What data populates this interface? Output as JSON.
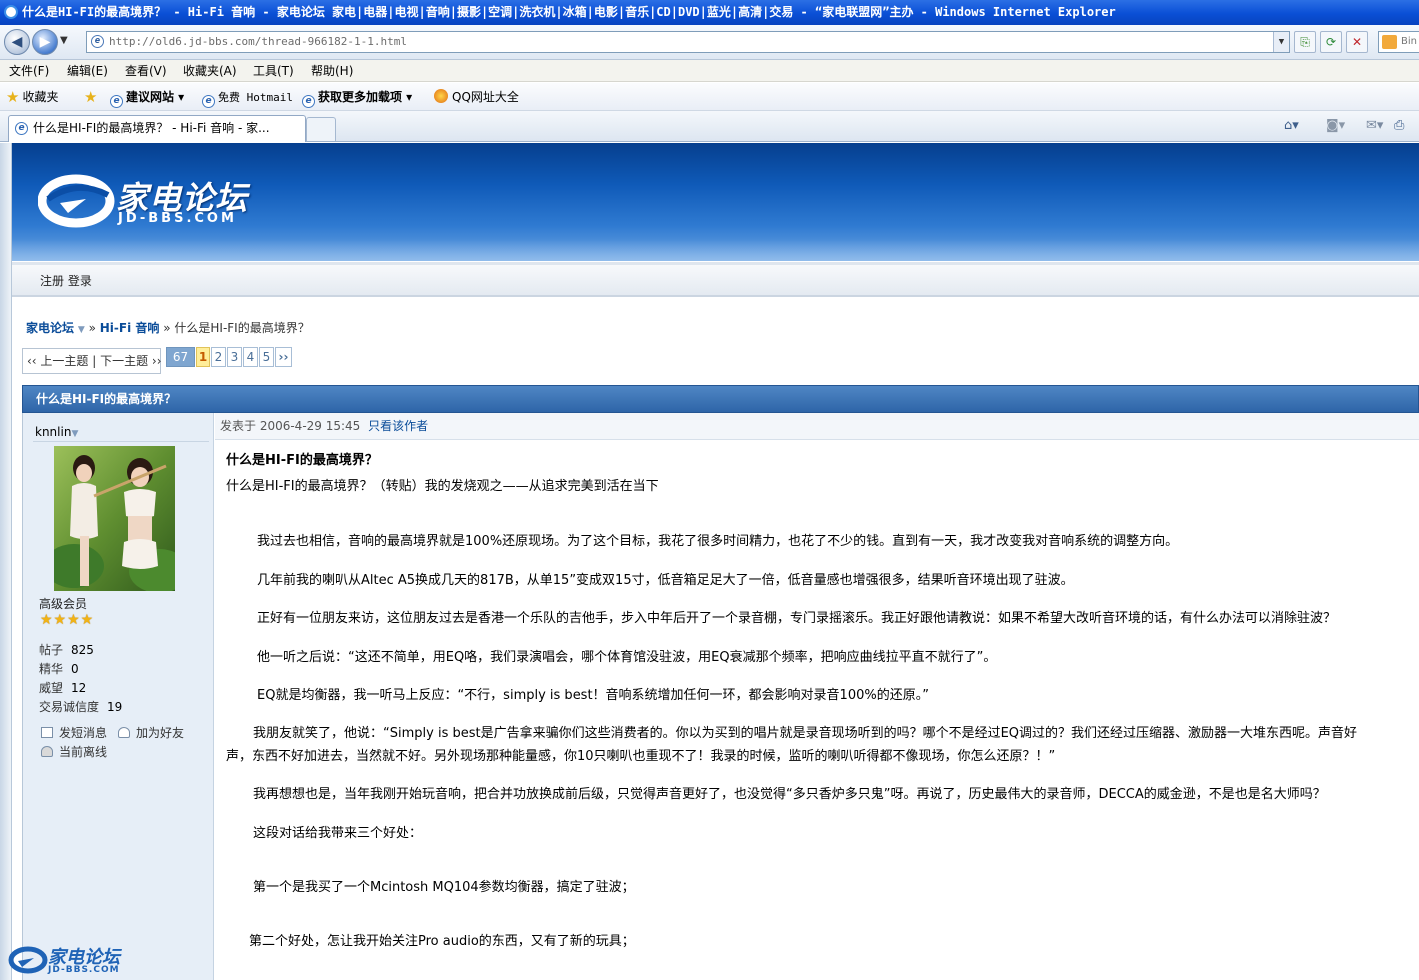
{
  "window": {
    "title": "什么是HI-FI的最高境界？ - Hi-Fi 音响 - 家电论坛 家电|电器|电视|音响|摄影|空调|洗衣机|冰箱|电影|音乐|CD|DVD|蓝光|高清|交易 - “家电联盟网”主办 - Windows Internet Explorer"
  },
  "address": {
    "url": "http://old6.jd-bbs.com/thread-966182-1-1.html",
    "search_text": "Bin"
  },
  "menu": [
    "文件(F)",
    "编辑(E)",
    "查看(V)",
    "收藏夹(A)",
    "工具(T)",
    "帮助(H)"
  ],
  "favorites": {
    "fav_label": "收藏夹",
    "items": [
      "建议网站 ▾",
      "免费 Hotmail",
      "获取更多加载项 ▾",
      "QQ网址大全"
    ]
  },
  "tab": {
    "label": "什么是HI-FI的最高境界？ - Hi-Fi 音响 - 家..."
  },
  "site": {
    "logo_text": "家电论坛",
    "logo_sub": "JD-BBS.COM",
    "login_links": "注册 登录",
    "watermark_text": "家电论坛",
    "watermark_sub": "JD-BBS.COM"
  },
  "breadcrumb": {
    "home": "家电论坛",
    "sep1": " » ",
    "forum": "Hi-Fi 音响",
    "sep2": " » ",
    "current": "什么是HI-FI的最高境界？"
  },
  "pager": {
    "prev_next": "‹‹ 上一主题 | 下一主题 ››",
    "total": "67",
    "pages": [
      "1",
      "2",
      "3",
      "4",
      "5"
    ],
    "next": "››"
  },
  "post": {
    "header_title": "什么是HI-FI的最高境界？",
    "author": "knnlin",
    "rank": "高级会员",
    "stars": "★★★★",
    "stats": [
      {
        "label": "帖子",
        "value": "825"
      },
      {
        "label": "精华",
        "value": "0"
      },
      {
        "label": "威望",
        "value": "12"
      },
      {
        "label": "交易诚信度",
        "value": "19"
      }
    ],
    "actions": {
      "pm": "发短消息",
      "friend": "加为好友",
      "status": "当前离线"
    },
    "meta_time": "发表于 2006-4-29 15:45",
    "meta_only": "只看该作者",
    "title": "什么是HI-FI的最高境界？",
    "subtitle": "什么是HI-FI的最高境界？（转贴）我的发烧观之——从追求完美到活在当下",
    "paragraphs": [
      "我过去也相信，音响的最高境界就是100%还原现场。为了这个目标，我花了很多时间精力，也花了不少的钱。直到有一天，我才改变我对音响系统的调整方向。",
      "几年前我的喇叭从Altec A5换成几天的817B，从单15”变成双15寸，低音箱足足大了一倍，低音量感也增强很多，结果听音环境出现了驻波。",
      "正好有一位朋友来访，这位朋友过去是香港一个乐队的吉他手，步入中年后开了一个录音棚，专门录摇滚乐。我正好跟他请教说：如果不希望大改听音环境的话，有什么办法可以消除驻波？",
      "他一听之后说：“这还不简单，用EQ咯，我们录演唱会，哪个体育馆没驻波，用EQ衰减那个频率，把响应曲线拉平直不就行了”。",
      "EQ就是均衡器，我一听马上反应：“不行，simply is best！音响系统增加任何一环，都会影响对录音100%的还原。”",
      "我朋友就笑了，他说：“Simply is best是广告拿来骗你们这些消费者的。你以为买到的唱片就是录音现场听到的吗？哪个不是经过EQ调过的？我们还经过压缩器、激励器一大堆东西呢。声音好",
      "声，东西不好加进去，当然就不好。另外现场那种能量感，你10只喇叭也重现不了！我录的时候，监听的喇叭听得都不像现场，你怎么还原？！”",
      "我再想想也是，当年我刚开始玩音响，把合并功放换成前后级，只觉得声音更好了，也没觉得“多只香炉多只鬼”呀。再说了，历史最伟大的录音师，DECCA的威金逊，不是也是名大师吗？",
      "这段对话给我带来三个好处：",
      "第一个是我买了一个Mcintosh MQ104参数均衡器，搞定了驻波；",
      "第二个好处，怎让我开始关注Pro audio的东西，又有了新的玩具；"
    ]
  }
}
